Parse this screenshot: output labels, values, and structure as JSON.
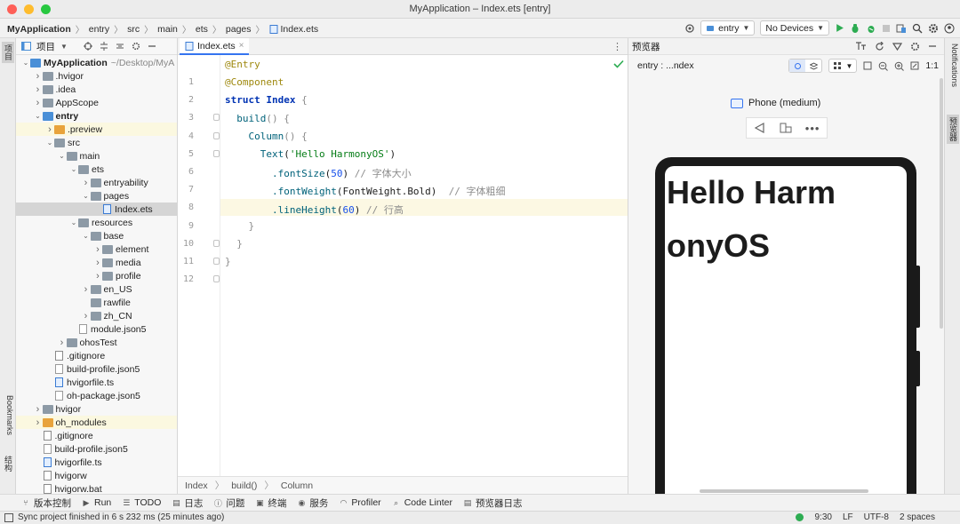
{
  "window": {
    "title": "MyApplication – Index.ets [entry]"
  },
  "breadcrumb": [
    "MyApplication",
    "entry",
    "src",
    "main",
    "ets",
    "pages",
    "Index.ets"
  ],
  "toolbar": {
    "module": "entry",
    "device": "No Devices"
  },
  "left_strip": {
    "project": "项目",
    "bookmarks": "Bookmarks",
    "structure": "结构"
  },
  "project_panel": {
    "title": "项目",
    "tree": [
      {
        "label": "MyApplication",
        "extra": "~/Desktop/MyA",
        "depth": 0,
        "arrow": "down",
        "icon": "folder-module",
        "bold": true
      },
      {
        "label": ".hvigor",
        "depth": 1,
        "arrow": "right",
        "icon": "folder"
      },
      {
        "label": ".idea",
        "depth": 1,
        "arrow": "right",
        "icon": "folder"
      },
      {
        "label": "AppScope",
        "depth": 1,
        "arrow": "right",
        "icon": "folder"
      },
      {
        "label": "entry",
        "depth": 1,
        "arrow": "down",
        "icon": "folder-module",
        "bold": true
      },
      {
        "label": ".preview",
        "depth": 2,
        "arrow": "right",
        "icon": "folder-orange",
        "highlight": true
      },
      {
        "label": "src",
        "depth": 2,
        "arrow": "down",
        "icon": "folder"
      },
      {
        "label": "main",
        "depth": 3,
        "arrow": "down",
        "icon": "folder"
      },
      {
        "label": "ets",
        "depth": 4,
        "arrow": "down",
        "icon": "folder"
      },
      {
        "label": "entryability",
        "depth": 5,
        "arrow": "right",
        "icon": "folder"
      },
      {
        "label": "pages",
        "depth": 5,
        "arrow": "down",
        "icon": "folder"
      },
      {
        "label": "Index.ets",
        "depth": 6,
        "arrow": "",
        "icon": "file-ets",
        "selected": true
      },
      {
        "label": "resources",
        "depth": 4,
        "arrow": "down",
        "icon": "folder"
      },
      {
        "label": "base",
        "depth": 5,
        "arrow": "down",
        "icon": "folder"
      },
      {
        "label": "element",
        "depth": 6,
        "arrow": "right",
        "icon": "folder"
      },
      {
        "label": "media",
        "depth": 6,
        "arrow": "right",
        "icon": "folder"
      },
      {
        "label": "profile",
        "depth": 6,
        "arrow": "right",
        "icon": "folder"
      },
      {
        "label": "en_US",
        "depth": 5,
        "arrow": "right",
        "icon": "folder"
      },
      {
        "label": "rawfile",
        "depth": 5,
        "arrow": "",
        "icon": "folder"
      },
      {
        "label": "zh_CN",
        "depth": 5,
        "arrow": "right",
        "icon": "folder"
      },
      {
        "label": "module.json5",
        "depth": 4,
        "arrow": "",
        "icon": "file-json"
      },
      {
        "label": "ohosTest",
        "depth": 3,
        "arrow": "right",
        "icon": "folder"
      },
      {
        "label": ".gitignore",
        "depth": 2,
        "arrow": "",
        "icon": "file"
      },
      {
        "label": "build-profile.json5",
        "depth": 2,
        "arrow": "",
        "icon": "file-json"
      },
      {
        "label": "hvigorfile.ts",
        "depth": 2,
        "arrow": "",
        "icon": "file-ts"
      },
      {
        "label": "oh-package.json5",
        "depth": 2,
        "arrow": "",
        "icon": "file-json"
      },
      {
        "label": "hvigor",
        "depth": 1,
        "arrow": "right",
        "icon": "folder"
      },
      {
        "label": "oh_modules",
        "depth": 1,
        "arrow": "right",
        "icon": "folder-orange",
        "highlight": true
      },
      {
        "label": ".gitignore",
        "depth": 1,
        "arrow": "",
        "icon": "file"
      },
      {
        "label": "build-profile.json5",
        "depth": 1,
        "arrow": "",
        "icon": "file-json"
      },
      {
        "label": "hvigorfile.ts",
        "depth": 1,
        "arrow": "",
        "icon": "file-ts"
      },
      {
        "label": "hvigorw",
        "depth": 1,
        "arrow": "",
        "icon": "file"
      },
      {
        "label": "hvigorw.bat",
        "depth": 1,
        "arrow": "",
        "icon": "file"
      }
    ]
  },
  "editor": {
    "tab": "Index.ets",
    "current_line": 9,
    "lines": [
      [
        {
          "t": "@Entry",
          "c": "ann"
        }
      ],
      [
        {
          "t": "@Component",
          "c": "ann"
        }
      ],
      [
        {
          "t": "struct ",
          "c": "kw"
        },
        {
          "t": "Index",
          "c": "kw"
        },
        {
          "t": " {",
          "c": "br"
        }
      ],
      [
        {
          "t": "  build",
          "c": "fn"
        },
        {
          "t": "() {",
          "c": "br"
        }
      ],
      [
        {
          "t": "    Column",
          "c": "fn"
        },
        {
          "t": "() {",
          "c": "br"
        }
      ],
      [
        {
          "t": "      Text",
          "c": "fn"
        },
        {
          "t": "(",
          "c": ""
        },
        {
          "t": "'Hello HarmonyOS'",
          "c": "str"
        },
        {
          "t": ")",
          "c": ""
        }
      ],
      [
        {
          "t": "        .fontSize",
          "c": "fn"
        },
        {
          "t": "(",
          "c": ""
        },
        {
          "t": "50",
          "c": "num"
        },
        {
          "t": ") ",
          "c": ""
        },
        {
          "t": "// 字体大小",
          "c": "cm"
        }
      ],
      [
        {
          "t": "        .fontWeight",
          "c": "fn"
        },
        {
          "t": "(FontWeight.Bold)  ",
          "c": ""
        },
        {
          "t": "// 字体粗细",
          "c": "cm"
        }
      ],
      [
        {
          "t": "        .lineHeight",
          "c": "fn"
        },
        {
          "t": "(",
          "c": ""
        },
        {
          "t": "60",
          "c": "num"
        },
        {
          "t": ") ",
          "c": ""
        },
        {
          "t": "// 行高",
          "c": "cm"
        }
      ],
      [
        {
          "t": "    }",
          "c": "br"
        }
      ],
      [
        {
          "t": "  }",
          "c": "br"
        }
      ],
      [
        {
          "t": "}",
          "c": "br"
        }
      ]
    ],
    "breadcrumb": [
      "Index",
      "build()",
      "Column"
    ]
  },
  "previewer": {
    "title": "预览器",
    "target": "entry : ...ndex",
    "device": "Phone (medium)",
    "screen_text": "Hello HarmonyOS",
    "zoom": "1:1"
  },
  "right_strip": {
    "notifications": "Notifications",
    "previewer": "预览器"
  },
  "bottom_tools": [
    {
      "icon": "vcs-icon",
      "label": "版本控制"
    },
    {
      "icon": "run-icon",
      "label": "Run"
    },
    {
      "icon": "todo-icon",
      "label": "TODO"
    },
    {
      "icon": "log-icon",
      "label": "日志"
    },
    {
      "icon": "problems-icon",
      "label": "问题"
    },
    {
      "icon": "terminal-icon",
      "label": "终端"
    },
    {
      "icon": "services-icon",
      "label": "服务"
    },
    {
      "icon": "profiler-icon",
      "label": "Profiler"
    },
    {
      "icon": "code-linter-icon",
      "label": "Code Linter"
    },
    {
      "icon": "preview-log-icon",
      "label": "预览器日志"
    }
  ],
  "status": {
    "message": "Sync project finished in 6 s 232 ms (25 minutes ago)",
    "position": "9:30",
    "line_ending": "LF",
    "encoding": "UTF-8",
    "indent": "2 spaces"
  },
  "colors": {
    "accent": "#3574f0",
    "run_green": "#2dac52",
    "current_line": "#fcf8e3"
  }
}
